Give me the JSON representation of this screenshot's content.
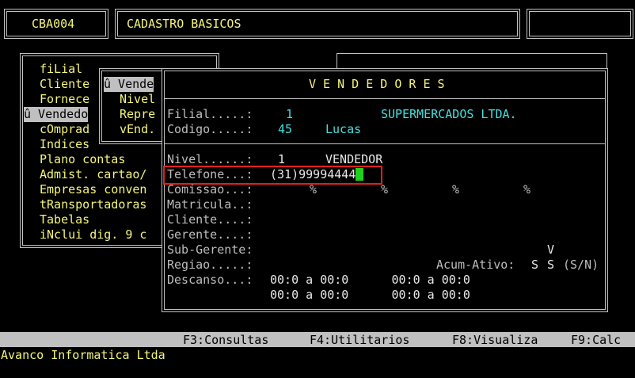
{
  "header": {
    "code": "CBA004",
    "title": "CADASTRO BASICOS"
  },
  "main_menu": {
    "items": [
      {
        "label": "fiLial",
        "selected": false
      },
      {
        "label": "Cliente",
        "selected": false
      },
      {
        "label": "Fornece",
        "selected": false
      },
      {
        "label": "û Vendedo",
        "selected": true
      },
      {
        "label": "cOmprad",
        "selected": false
      },
      {
        "label": "Indices",
        "selected": false
      },
      {
        "label": "Plano contas",
        "selected": false
      },
      {
        "label": "Admist. cartao/",
        "selected": false
      },
      {
        "label": "Empresas conven",
        "selected": false
      },
      {
        "label": "tRansportadoras",
        "selected": false
      },
      {
        "label": "Tabelas",
        "selected": false
      },
      {
        "label": "iNclui dig. 9 c",
        "selected": false
      }
    ]
  },
  "sub_menu": {
    "items": [
      {
        "label": "û Vende",
        "selected": true
      },
      {
        "label": "Nivel",
        "selected": false
      },
      {
        "label": "Repre",
        "selected": false
      },
      {
        "label": "vEnd.",
        "selected": false
      }
    ]
  },
  "form": {
    "title": "V E N D E D O R E S",
    "filial_label": "Filial.....:",
    "filial_value": "1",
    "filial_name": "SUPERMERCADOS LTDA.",
    "codigo_label": "Codigo.....:",
    "codigo_value": "45",
    "codigo_name": "Lucas",
    "nivel_label": "Nivel......:",
    "nivel_value": "1",
    "nivel_name": "VENDEDOR",
    "telefone_label": "Telefone...:",
    "telefone_value": "(31)99994444",
    "comissao_label": "Comissao...:",
    "comissao_pct": [
      "%",
      "%",
      "%",
      "%"
    ],
    "matricula_label": "Matricula..:",
    "cliente_label": "Cliente....:",
    "gerente_label": "Gerente....:",
    "subgerente_label": "Sub-Gerente:",
    "subgerente_flag": "V",
    "regiao_label": "Regiao.....:",
    "acum_label": "Acum-Ativo:",
    "acum_value1": "S",
    "acum_value2": "S",
    "acum_hint": "(S/N)",
    "descanso_label": "Descanso...:",
    "descanso_row1": "00:0 a 00:0      00:0 a 00:0",
    "descanso_row2": "00:0 a 00:0      00:0 a 00:0"
  },
  "function_keys": {
    "f3": "F3:Consultas",
    "f4": "F4:Utilitarios",
    "f8": "F8:Visualiza",
    "f9": "F9:Calc"
  },
  "footer": {
    "company": "Avanco Informatica Ltda"
  },
  "colors": {
    "background": "#000000",
    "yellow_text": "#f5f57a",
    "cyan_value": "#45e0e0",
    "highlight": "#c0c0c0",
    "cursor": "#1fd11f",
    "annotation_box": "#e0201c"
  }
}
